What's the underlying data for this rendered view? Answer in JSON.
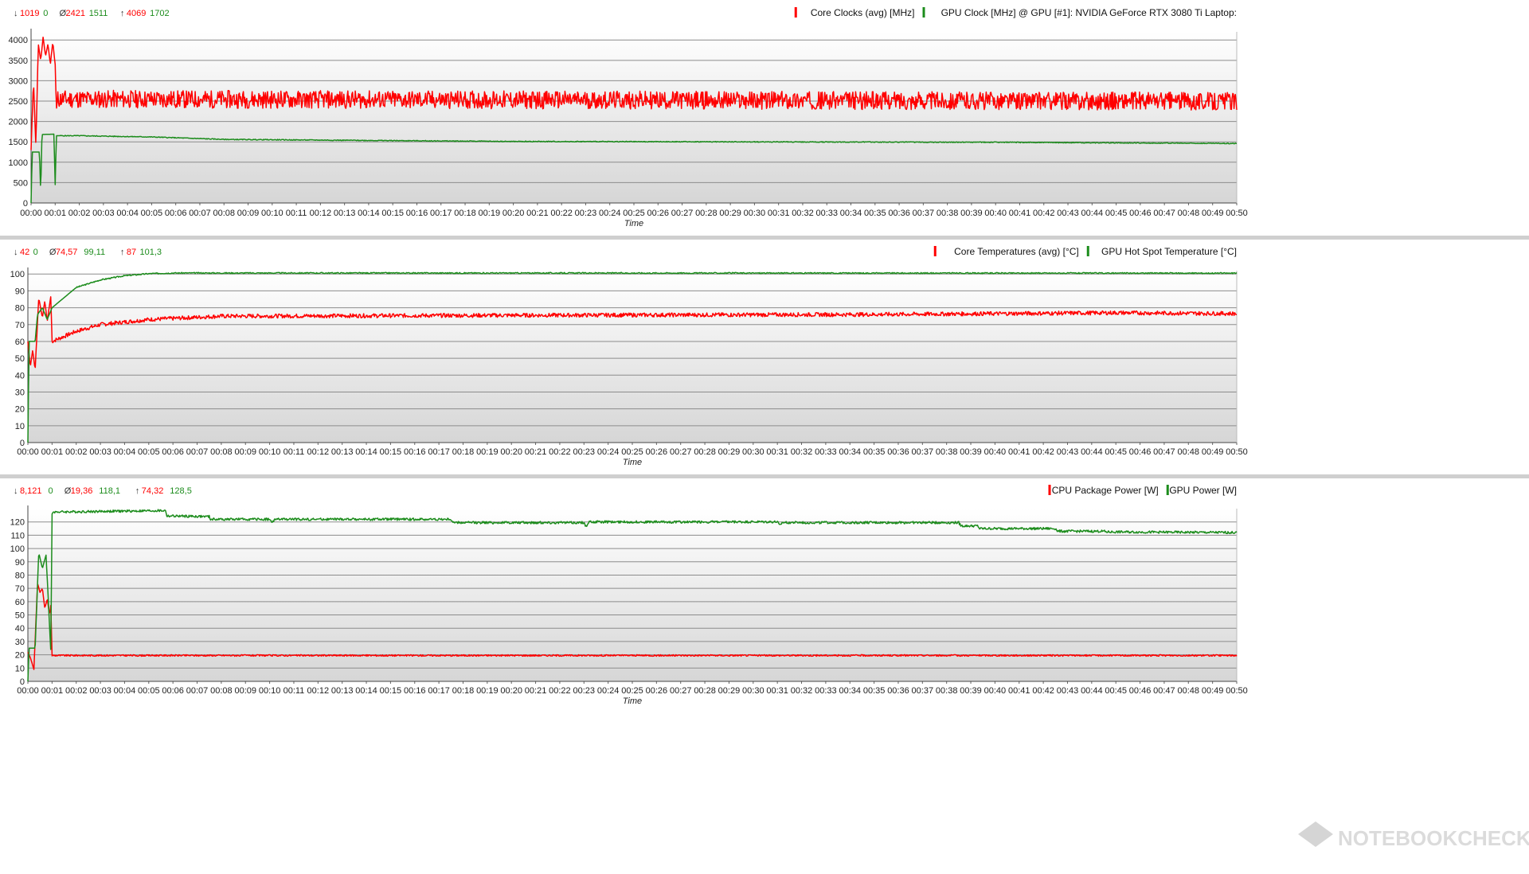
{
  "colors": {
    "red": "#ff0000",
    "green": "#1c8c1c",
    "separator": "#cfcfcf",
    "grid": "#8c8c8c"
  },
  "watermark": {
    "text": "NOTEBOOKCHECK",
    "icon": "notebookcheck-logo-icon"
  },
  "chart_data": [
    {
      "type": "line",
      "title": "",
      "xlabel": "Time",
      "ylabel": "",
      "x_ticks": [
        "00:00",
        "00:01",
        "00:02",
        "00:03",
        "00:04",
        "00:05",
        "00:06",
        "00:07",
        "00:08",
        "00:09",
        "00:10",
        "00:11",
        "00:12",
        "00:13",
        "00:14",
        "00:15",
        "00:16",
        "00:17",
        "00:18",
        "00:19",
        "00:20",
        "00:21",
        "00:22",
        "00:23",
        "00:24",
        "00:25",
        "00:26",
        "00:27",
        "00:28",
        "00:29",
        "00:30",
        "00:31",
        "00:32",
        "00:33",
        "00:34",
        "00:35",
        "00:36",
        "00:37",
        "00:38",
        "00:39",
        "00:40",
        "00:41",
        "00:42",
        "00:43",
        "00:44",
        "00:45",
        "00:46",
        "00:47",
        "00:48",
        "00:49",
        "00:50"
      ],
      "xlim": [
        0,
        50
      ],
      "ylim": [
        0,
        4200
      ],
      "y_ticks": [
        0,
        500,
        1000,
        1500,
        2000,
        2500,
        3000,
        3500,
        4000
      ],
      "stats": {
        "min": [
          "1019",
          "0"
        ],
        "avg": [
          "2421",
          "1511"
        ],
        "max": [
          "4069",
          "1702"
        ]
      },
      "legend": [
        {
          "name": "Core Clocks (avg) [MHz]",
          "color": "#ff0000"
        },
        {
          "name": "GPU Clock [MHz] @ GPU [#1]: NVIDIA GeForce RTX 3080 Ti Laptop:",
          "color": "#1c8c1c"
        }
      ],
      "series": [
        {
          "name": "Core Clocks (avg) [MHz]",
          "color": "#ff0000",
          "key": [
            [
              0,
              1300
            ],
            [
              0.1,
              3000
            ],
            [
              0.2,
              1400
            ],
            [
              0.3,
              3900
            ],
            [
              0.4,
              3500
            ],
            [
              0.5,
              4069
            ],
            [
              0.6,
              3600
            ],
            [
              0.7,
              3900
            ],
            [
              0.8,
              3400
            ],
            [
              0.9,
              3950
            ],
            [
              1.0,
              3400
            ],
            [
              1.05,
              2300
            ],
            [
              1.1,
              2550
            ],
            [
              50,
              2500
            ]
          ],
          "noise": {
            "from": 1.1,
            "amp": 220,
            "seed": 11
          }
        },
        {
          "name": "GPU Clock [MHz] @ GPU [#1]: NVIDIA GeForce RTX 3080 Ti Laptop:",
          "color": "#1c8c1c",
          "key": [
            [
              0,
              0
            ],
            [
              0.05,
              1250
            ],
            [
              0.35,
              1250
            ],
            [
              0.4,
              200
            ],
            [
              0.45,
              1680
            ],
            [
              0.95,
              1690
            ],
            [
              1.0,
              450
            ],
            [
              1.05,
              1650
            ],
            [
              2,
              1650
            ],
            [
              5,
              1620
            ],
            [
              8,
              1560
            ],
            [
              20,
              1510
            ],
            [
              40,
              1490
            ],
            [
              50,
              1460
            ]
          ],
          "noise": {
            "from": 1.2,
            "amp": 10,
            "seed": 5
          }
        }
      ]
    },
    {
      "type": "line",
      "title": "",
      "xlabel": "Time",
      "ylabel": "",
      "x_ticks": [
        "00:00",
        "00:01",
        "00:02",
        "00:03",
        "00:04",
        "00:05",
        "00:06",
        "00:07",
        "00:08",
        "00:09",
        "00:10",
        "00:11",
        "00:12",
        "00:13",
        "00:14",
        "00:15",
        "00:16",
        "00:17",
        "00:18",
        "00:19",
        "00:20",
        "00:21",
        "00:22",
        "00:23",
        "00:24",
        "00:25",
        "00:26",
        "00:27",
        "00:28",
        "00:29",
        "00:30",
        "00:31",
        "00:32",
        "00:33",
        "00:34",
        "00:35",
        "00:36",
        "00:37",
        "00:38",
        "00:39",
        "00:40",
        "00:41",
        "00:42",
        "00:43",
        "00:44",
        "00:45",
        "00:46",
        "00:47",
        "00:48",
        "00:49",
        "00:50"
      ],
      "xlim": [
        0,
        50
      ],
      "ylim": [
        0,
        102
      ],
      "y_ticks": [
        0,
        10,
        20,
        30,
        40,
        50,
        60,
        70,
        80,
        90,
        100
      ],
      "stats": {
        "min": [
          "42",
          "0"
        ],
        "avg": [
          "74,57",
          "99,11"
        ],
        "max": [
          "87",
          "101,3"
        ]
      },
      "legend": [
        {
          "name": "Core Temperatures (avg) [°C]",
          "color": "#ff0000"
        },
        {
          "name": "GPU Hot Spot Temperature [°C]",
          "color": "#1c8c1c"
        }
      ],
      "series": [
        {
          "name": "Core Temperatures (avg) [°C]",
          "color": "#ff0000",
          "key": [
            [
              0,
              60
            ],
            [
              0.1,
              45
            ],
            [
              0.2,
              55
            ],
            [
              0.3,
              43
            ],
            [
              0.45,
              86
            ],
            [
              0.6,
              74
            ],
            [
              0.7,
              84
            ],
            [
              0.8,
              72
            ],
            [
              0.95,
              87
            ],
            [
              1.0,
              60
            ],
            [
              2,
              66
            ],
            [
              3,
              70
            ],
            [
              5,
              73
            ],
            [
              8,
              75
            ],
            [
              20,
              75.5
            ],
            [
              35,
              76
            ],
            [
              45,
              77
            ],
            [
              50,
              76.5
            ]
          ],
          "noise": {
            "from": 1.0,
            "amp": 1.2,
            "seed": 7
          }
        },
        {
          "name": "GPU Hot Spot Temperature [°C]",
          "color": "#1c8c1c",
          "key": [
            [
              0,
              0
            ],
            [
              0.05,
              60
            ],
            [
              0.3,
              60
            ],
            [
              0.4,
              76
            ],
            [
              0.6,
              80
            ],
            [
              0.8,
              73
            ],
            [
              1.0,
              80
            ],
            [
              2,
              92
            ],
            [
              3,
              96.5
            ],
            [
              4,
              99
            ],
            [
              5,
              100.2
            ],
            [
              6,
              100.6
            ],
            [
              50,
              100.5
            ]
          ],
          "noise": {
            "from": 2.0,
            "amp": 0.35,
            "seed": 3
          }
        }
      ]
    },
    {
      "type": "line",
      "title": "",
      "xlabel": "Time",
      "ylabel": "",
      "x_ticks": [
        "00:00",
        "00:01",
        "00:02",
        "00:03",
        "00:04",
        "00:05",
        "00:06",
        "00:07",
        "00:08",
        "00:09",
        "00:10",
        "00:11",
        "00:12",
        "00:13",
        "00:14",
        "00:15",
        "00:16",
        "00:17",
        "00:18",
        "00:19",
        "00:20",
        "00:21",
        "00:22",
        "00:23",
        "00:24",
        "00:25",
        "00:26",
        "00:27",
        "00:28",
        "00:29",
        "00:30",
        "00:31",
        "00:32",
        "00:33",
        "00:34",
        "00:35",
        "00:36",
        "00:37",
        "00:38",
        "00:39",
        "00:40",
        "00:41",
        "00:42",
        "00:43",
        "00:44",
        "00:45",
        "00:46",
        "00:47",
        "00:48",
        "00:49",
        "00:50"
      ],
      "xlim": [
        0,
        50
      ],
      "ylim": [
        0,
        130
      ],
      "y_ticks": [
        0,
        10,
        20,
        30,
        40,
        50,
        60,
        70,
        80,
        90,
        100,
        110,
        120
      ],
      "stats": {
        "min": [
          "8,121",
          "0"
        ],
        "avg": [
          "19,36",
          "118,1"
        ],
        "max": [
          "74,32",
          "128,5"
        ]
      },
      "legend": [
        {
          "name": "CPU Package Power [W]",
          "color": "#ff0000"
        },
        {
          "name": "GPU Power [W]",
          "color": "#1c8c1c"
        }
      ],
      "series": [
        {
          "name": "CPU Package Power [W]",
          "color": "#ff0000",
          "key": [
            [
              0,
              22
            ],
            [
              0.1,
              18
            ],
            [
              0.25,
              9
            ],
            [
              0.4,
              74
            ],
            [
              0.5,
              67
            ],
            [
              0.6,
              70
            ],
            [
              0.7,
              55
            ],
            [
              0.8,
              62
            ],
            [
              0.9,
              50
            ],
            [
              0.95,
              58
            ],
            [
              1.0,
              19.5
            ],
            [
              50,
              19.5
            ]
          ],
          "noise": {
            "from": 1.0,
            "amp": 0.6,
            "seed": 9
          }
        },
        {
          "name": "GPU Power [W]",
          "color": "#1c8c1c",
          "key": [
            [
              0,
              0
            ],
            [
              0.05,
              25
            ],
            [
              0.3,
              25
            ],
            [
              0.45,
              97
            ],
            [
              0.6,
              85
            ],
            [
              0.75,
              95
            ],
            [
              0.85,
              60
            ],
            [
              0.9,
              40
            ],
            [
              0.95,
              22
            ],
            [
              1.0,
              126
            ],
            [
              1.05,
              127.5
            ],
            [
              5.7,
              128.5
            ],
            [
              5.75,
              124.5
            ],
            [
              7.5,
              124
            ],
            [
              7.55,
              122
            ],
            [
              10,
              122
            ],
            [
              10.1,
              119
            ],
            [
              10.2,
              122
            ],
            [
              17.5,
              122
            ],
            [
              17.6,
              119.5
            ],
            [
              23,
              119.5
            ],
            [
              23.1,
              116
            ],
            [
              23.2,
              120
            ],
            [
              31,
              120
            ],
            [
              31.1,
              117
            ],
            [
              31.2,
              119.5
            ],
            [
              38.5,
              119.5
            ],
            [
              38.6,
              117
            ],
            [
              39.3,
              117
            ],
            [
              39.35,
              115
            ],
            [
              42.5,
              115
            ],
            [
              42.6,
              113
            ],
            [
              44.5,
              113
            ],
            [
              44.6,
              112.5
            ],
            [
              50,
              112
            ]
          ],
          "noise": {
            "from": 1.1,
            "amp": 0.9,
            "seed": 4
          }
        }
      ]
    }
  ]
}
